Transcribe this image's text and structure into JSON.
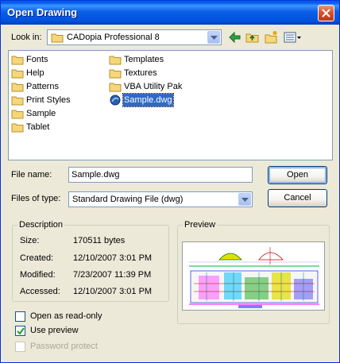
{
  "window": {
    "title": "Open Drawing"
  },
  "look_in": {
    "label": "Look in:",
    "value": "CADopia Professional 8"
  },
  "toolbar": [
    "back-icon",
    "up-folder-icon",
    "new-folder-icon",
    "views-menu-icon"
  ],
  "files": [
    {
      "name": "Fonts",
      "type": "folder"
    },
    {
      "name": "Help",
      "type": "folder"
    },
    {
      "name": "Patterns",
      "type": "folder"
    },
    {
      "name": "Print Styles",
      "type": "folder"
    },
    {
      "name": "Sample",
      "type": "folder"
    },
    {
      "name": "Tablet",
      "type": "folder"
    },
    {
      "name": "Templates",
      "type": "folder"
    },
    {
      "name": "Textures",
      "type": "folder"
    },
    {
      "name": "VBA Utility Pak",
      "type": "folder"
    },
    {
      "name": "Sample.dwg",
      "type": "dwg",
      "selected": true
    }
  ],
  "file_name": {
    "label": "File name:",
    "value": "Sample.dwg"
  },
  "file_type": {
    "label": "Files of type:",
    "value": "Standard Drawing File (dwg)"
  },
  "buttons": {
    "open": "Open",
    "cancel": "Cancel"
  },
  "description": {
    "title": "Description",
    "size_label": "Size:",
    "size_value": "170511 bytes",
    "created_label": "Created:",
    "created_value": "12/10/2007 3:01 PM",
    "modified_label": "Modified:",
    "modified_value": "7/23/2007 11:39 PM",
    "accessed_label": "Accessed:",
    "accessed_value": "12/10/2007 3:01 PM"
  },
  "preview": {
    "title": "Preview"
  },
  "options": {
    "read_only": {
      "label": "Open as read-only",
      "checked": false,
      "enabled": true
    },
    "use_preview": {
      "label": "Use preview",
      "checked": true,
      "enabled": true
    },
    "password": {
      "label": "Password protect",
      "checked": false,
      "enabled": false
    }
  },
  "colors": {
    "title_bar": "#0058ee",
    "selection": "#316ac5",
    "dialog_bg": "#ece9d8"
  }
}
